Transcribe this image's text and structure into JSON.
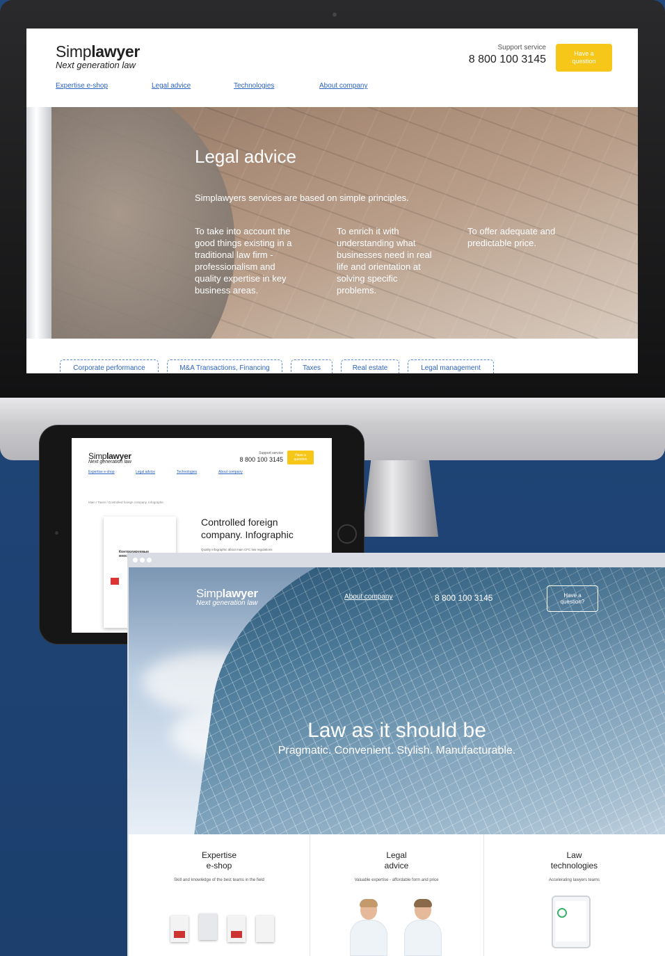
{
  "brand": {
    "logo_plain": "Simp",
    "logo_bold": "lawyer",
    "tagline": "Next generation law"
  },
  "desktop": {
    "support_label": "Support service",
    "phone": "8 800 100 3145",
    "ask_button": "Have a question",
    "nav": [
      "Expertise e-shop",
      "Legal advice",
      "Technologies",
      "About company"
    ],
    "hero": {
      "title": "Legal advice",
      "subtitle": "Simplawyers services are based on simple principles.",
      "columns": [
        "To take into account the good things existing in a traditional law firm - professionalism and quality expertise in key business areas.",
        "To enrich it with understanding what businesses need in real life and orientation at solving specific problems.",
        "To offer adequate and predictable price."
      ]
    },
    "tabs": [
      "Corporate performance",
      "M&A Transactions, Financing",
      "Taxes",
      "Real estate",
      "Legal management"
    ]
  },
  "tablet": {
    "support_label": "Support service",
    "phone": "8 800 100 3145",
    "ask_button": "Have a question",
    "nav": [
      "Expertise e-shop",
      "Legal advice",
      "Technologies",
      "About company"
    ],
    "breadcrumb": "Main / Taxes / Controlled foreign company. Infographic",
    "title": "Controlled foreign company. Infographic",
    "description": "Quality infographic about main CFC law regulations",
    "book_text": "Контролируемые иностр"
  },
  "browser": {
    "about": "About company",
    "phone": "8 800 100 3145",
    "ask_button": "Have a question?",
    "headline": "Law as it should be",
    "subheadline": "Pragmatic. Convenient. Stylish. Manufacturable.",
    "cards": [
      {
        "title": "Expertise e-shop",
        "desc": "Skill and knowledge of the best teams in the field"
      },
      {
        "title": "Legal advice",
        "desc": "Valuable expertise - affordable form and price"
      },
      {
        "title": "Law technologies",
        "desc": "Accelerating lawyers teams"
      }
    ]
  },
  "colors": {
    "accent_yellow": "#f6c619",
    "link_blue": "#2b63c0",
    "background_navy": "#1f4577"
  },
  "icons": [
    "window-dot-icon",
    "camera-icon",
    "home-button-icon"
  ]
}
